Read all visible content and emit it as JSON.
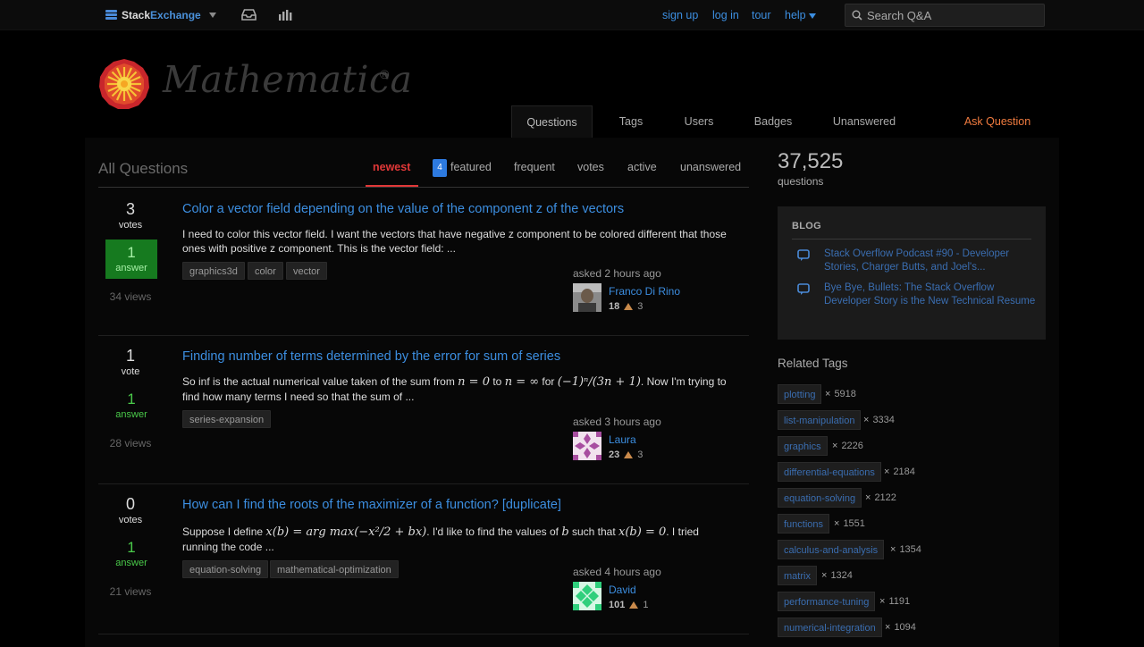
{
  "topbar": {
    "brand_stack": "Stack",
    "brand_exchange": "Exchange",
    "links": {
      "signup": "sign up",
      "login": "log in",
      "tour": "tour",
      "help": "help"
    },
    "search_placeholder": "Search Q&A"
  },
  "site": {
    "name": "Mathematica",
    "reg": "®"
  },
  "nav": {
    "questions": "Questions",
    "tags": "Tags",
    "users": "Users",
    "badges": "Badges",
    "unanswered": "Unanswered",
    "ask": "Ask Question"
  },
  "main": {
    "title": "All Questions",
    "filters": {
      "newest": "newest",
      "featured_count": "4",
      "featured": "featured",
      "frequent": "frequent",
      "votes": "votes",
      "active": "active",
      "unanswered": "unanswered"
    }
  },
  "questions": [
    {
      "votes": "3",
      "votes_label": "votes",
      "answers": "1",
      "answers_label": "answer",
      "views": "34 views",
      "title": "Color a vector field depending on the value of the component z of the vectors",
      "excerpt": "I need to color this vector field. I want the vectors that have negative z component to be colored different that those ones with positive z component. This is the vector field: ...",
      "tags": [
        "graphics3d",
        "color",
        "vector"
      ],
      "asked": "asked 2 hours ago",
      "user": "Franco Di Rino",
      "rep": "18",
      "bronze": "3"
    },
    {
      "votes": "1",
      "votes_label": "vote",
      "answers": "1",
      "answers_label": "answer",
      "views": "28 views",
      "title": "Finding number of terms determined by the error for sum of series",
      "excerpt_a": "So inf is the actual numerical value taken of the sum from",
      "math_a": "n = 0",
      "excerpt_b": "to",
      "math_b": "n = ∞",
      "excerpt_c": "for",
      "math_c": "(−1)ⁿ/(3n + 1)",
      "excerpt_d": ". Now",
      "excerpt_e": "I'm trying to find how many terms I need so that the sum of ...",
      "tags": [
        "series-expansion"
      ],
      "asked": "asked 3 hours ago",
      "user": "Laura",
      "rep": "23",
      "bronze": "3"
    },
    {
      "votes": "0",
      "votes_label": "votes",
      "answers": "1",
      "answers_label": "answer",
      "views": "21 views",
      "title": "How can I find the roots of the maximizer of a function? [duplicate]",
      "excerpt_a": "Suppose I define",
      "math_a": "x(b) = arg max(−x²/2 + bx)",
      "excerpt_b": ". I'd like to find the values of",
      "math_b": "b",
      "excerpt_c": "such that",
      "math_c": "x(b) = 0",
      "excerpt_d": ". I",
      "excerpt_e": "tried running the code ...",
      "tags": [
        "equation-solving",
        "mathematical-optimization"
      ],
      "asked": "asked 4 hours ago",
      "user": "David",
      "rep": "101",
      "bronze": "1"
    }
  ],
  "sidebar": {
    "count": "37,525",
    "count_label": "questions",
    "blog_heading": "BLOG",
    "blog_items": [
      "Stack Overflow Podcast #90 - Developer Stories, Charger Butts, and Joel's...",
      "Bye Bye, Bullets: The Stack Overflow Developer Story is the New Technical Resume"
    ],
    "related_title": "Related Tags",
    "related_tags": [
      {
        "name": "plotting",
        "count": "5918"
      },
      {
        "name": "list-manipulation",
        "count": "3334"
      },
      {
        "name": "graphics",
        "count": "2226"
      },
      {
        "name": "differential-equations",
        "count": "2184"
      },
      {
        "name": "equation-solving",
        "count": "2122"
      },
      {
        "name": "functions",
        "count": "1551"
      },
      {
        "name": "calculus-and-analysis",
        "count": "1354"
      },
      {
        "name": "matrix",
        "count": "1324"
      },
      {
        "name": "performance-tuning",
        "count": "1191"
      },
      {
        "name": "numerical-integration",
        "count": "1094"
      }
    ],
    "times": "×"
  },
  "colors": {
    "link": "#3c8ee0",
    "accepted": "#167a1f",
    "ask": "#f07b3f",
    "active_filter": "#e13838"
  }
}
